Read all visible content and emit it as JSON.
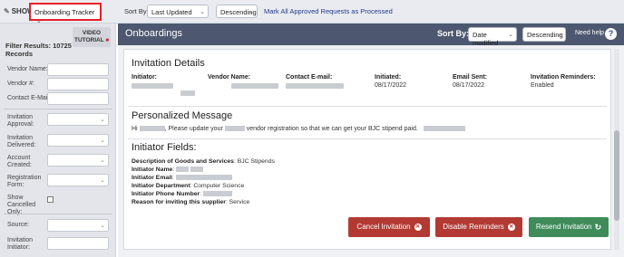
{
  "topbar": {
    "show_label": "SHOW",
    "show_value": "Onboarding Tracker",
    "sortby_label": "Sort By:",
    "sortby_value": "Last Updated",
    "order_value": "Descending",
    "mark_link": "Mark All Approved Requests as Processed"
  },
  "sidebar": {
    "video_tutorial": "VIDEO TUTORIAL",
    "filter_results_label": "Filter Results:",
    "filter_results_count": "10725",
    "filter_results_suffix": "Records",
    "fields": {
      "vendor_name": "Vendor Name:",
      "vendor_num": "Vendor #:",
      "contact_email": "Contact E-Mail:",
      "invitation_approval": "Invitation Approval:",
      "invitation_delivered": "Invitation Delivered:",
      "account_created": "Account Created:",
      "registration_form": "Registration Form:",
      "show_cancelled": "Show Cancelled Only:",
      "source": "Source:",
      "invitation_initiator": "Invitation Initiator:"
    }
  },
  "main": {
    "title": "Onboardings",
    "sortby_label": "Sort By:",
    "sortby_value": "Date modified",
    "order_value": "Descending",
    "need_help": "Need help",
    "help_icon": "?",
    "invitation_details": {
      "title": "Invitation Details",
      "initiator_label": "Initiator:",
      "vendor_name_label": "Vendor Name:",
      "contact_email_label": "Contact E-mail:",
      "initiated_label": "Initiated:",
      "initiated_value": "08/17/2022",
      "email_sent_label": "Email Sent:",
      "email_sent_value": "08/17/2022",
      "reminders_label": "Invitation Reminders:",
      "reminders_value": "Enabled"
    },
    "personalized_message": {
      "title": "Personalized Message",
      "text_hi": "Hi",
      "text_mid": ", Please update your",
      "text_end": "vendor registration so that we can get your BJC stipend paid."
    },
    "initiator_fields": {
      "title": "Initiator Fields:",
      "desc_label": "Description of Goods and Services",
      "desc_value": ": BJC Stipends",
      "name_label": "Initiator Name",
      "email_label": "Initiator Email",
      "dept_label": "Initiator Department",
      "dept_value": ": Computer Science",
      "phone_label": "Initiator Phone Number",
      "reason_label": "Reason for inviting this supplier",
      "reason_value": ": Service"
    },
    "buttons": {
      "cancel": "Cancel Invitation",
      "disable": "Disable Reminders",
      "resend": "Resend Invitation"
    }
  },
  "icons": {
    "edit": "pencil-icon",
    "camera": "video-camera-icon",
    "close": "close-circle-icon",
    "refresh": "refresh-icon",
    "chevron": "chevron-down-icon"
  },
  "colors": {
    "header_bg": "#4d5870",
    "highlight_border": "#e8202a",
    "btn_red": "#b23a33",
    "btn_green": "#3f8b5a",
    "link": "#1f3b8a"
  }
}
